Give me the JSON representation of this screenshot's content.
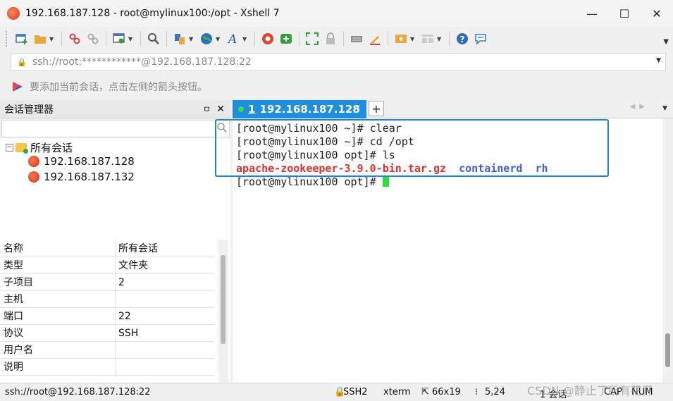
{
  "window": {
    "title": "192.168.187.128 - root@mylinux100:/opt - Xshell 7",
    "minimize": "—",
    "maximize": "☐",
    "close": "✕"
  },
  "toolbar": {
    "icons": [
      "new-session-icon",
      "open-folder-icon",
      "disconnect-icon",
      "reconnect-icon",
      "properties-icon",
      "search-icon",
      "transfer-icon",
      "globe-icon",
      "font-icon",
      "xshell-icon",
      "xftp-icon",
      "fullscreen-icon",
      "lock-icon",
      "keyboard-icon",
      "highlight-icon",
      "compose-icon",
      "layout-icon",
      "help-icon",
      "chat-icon"
    ]
  },
  "address": {
    "value": "ssh://root:************@192.168.187.128:22"
  },
  "hint": {
    "text": "要添加当前会话，点击左侧的箭头按钮。"
  },
  "session_manager": {
    "title": "会话管理器",
    "pin": "ㅁ",
    "close": "✕",
    "tree": {
      "root_toggle": "−",
      "root_label": "所有会话",
      "children": [
        "192.168.187.128",
        "192.168.187.132"
      ]
    },
    "properties": [
      {
        "name": "名称",
        "value": "所有会话"
      },
      {
        "name": "类型",
        "value": "文件夹"
      },
      {
        "name": "子项目",
        "value": "2"
      },
      {
        "name": "主机",
        "value": ""
      },
      {
        "name": "端口",
        "value": "22"
      },
      {
        "name": "协议",
        "value": "SSH"
      },
      {
        "name": "用户名",
        "value": ""
      },
      {
        "name": "说明",
        "value": ""
      }
    ]
  },
  "tabs": {
    "active": {
      "number": "1",
      "label": "192.168.187.128"
    },
    "close": "✕",
    "add": "+"
  },
  "terminal": {
    "lines": [
      "[root@mylinux100 ~]# clear",
      "[root@mylinux100 ~]# cd /opt",
      "[root@mylinux100 opt]# ls"
    ],
    "ls_output": {
      "archive": "apache-zookeeper-3.9.0-bin.tar.gz",
      "dirs": [
        "containerd",
        "rh"
      ]
    },
    "prompt": "[root@mylinux100 opt]# ",
    "colors": {
      "archive": "#e0322f",
      "directory": "#3f5ee8",
      "cursor": "#2fe03c"
    }
  },
  "status": {
    "connection": "ssh://root@192.168.187.128:22",
    "protocol": "SSH2",
    "terminal_type": "xterm",
    "size": "66x19",
    "position": "5,24",
    "sessions": "1 会话",
    "caps": "CAP",
    "num": "NUM"
  },
  "watermark": "CSDN @静止了所有花开",
  "colors": {
    "accent": "#1e8ee0"
  }
}
